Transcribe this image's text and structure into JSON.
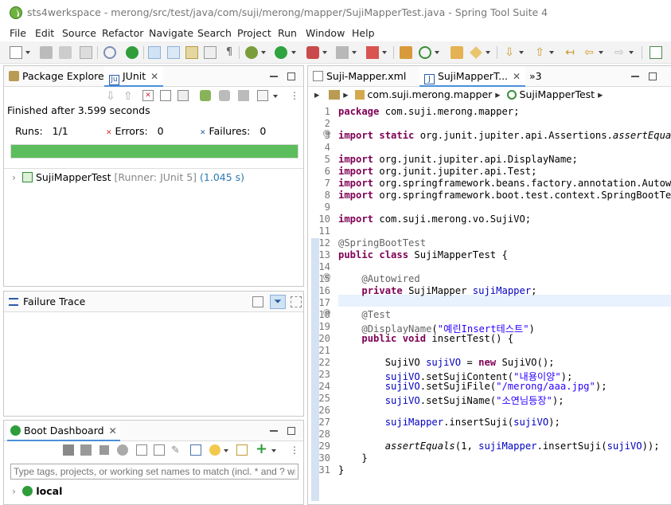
{
  "window": {
    "title": "sts4werkspace - merong/src/test/java/com/suji/merong/mapper/SujiMapperTest.java - Spring Tool Suite 4"
  },
  "menu": [
    "File",
    "Edit",
    "Source",
    "Refactor",
    "Navigate",
    "Search",
    "Project",
    "Run",
    "Window",
    "Help"
  ],
  "left_top": {
    "tabs": [
      {
        "label": "Package Explorer"
      },
      {
        "label": "JUnit"
      }
    ],
    "status": "Finished after 3.599 seconds",
    "runs_label": "Runs:",
    "runs_value": "1/1",
    "errors_label": "Errors:",
    "errors_value": "0",
    "failures_label": "Failures:",
    "failures_value": "0",
    "progress": 1.0,
    "progress_color": "#5bbd5b",
    "tree_item": {
      "name": "SujiMapperTest",
      "runner": "[Runner: JUnit 5]",
      "time": "(1.045 s)"
    }
  },
  "failure_trace": {
    "title": "Failure Trace"
  },
  "boot_dashboard": {
    "title": "Boot Dashboard",
    "filter_placeholder": "Type tags, projects, or working set names to match (incl. * and ? wildcards)",
    "item": "local"
  },
  "editor": {
    "tabs": [
      {
        "label": "Suji-Mapper.xml"
      },
      {
        "label": "SujiMapperT..."
      },
      {
        "label": "»3"
      }
    ],
    "breadcrumb": {
      "package": "com.suji.merong.mapper",
      "class": "SujiMapperTest"
    },
    "line_numbers": [
      "1",
      "2",
      "3",
      "4",
      "5",
      "6",
      "7",
      "8",
      "9",
      "10",
      "11",
      "12",
      "13",
      "14",
      "15",
      "16",
      "17",
      "18",
      "19",
      "20",
      "21",
      "22",
      "23",
      "24",
      "25",
      "26",
      "27",
      "28",
      "29",
      "30",
      "31"
    ]
  }
}
